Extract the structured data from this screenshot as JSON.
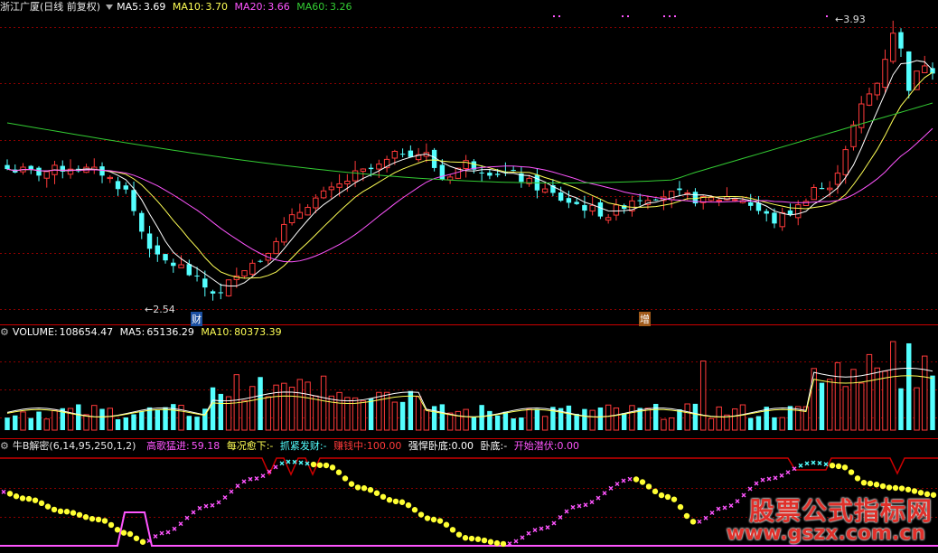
{
  "price_panel": {
    "stock_name": "浙江广厦(日线 前复权)",
    "ma5_label": "MA5:",
    "ma5_value": "3.69",
    "ma10_label": "MA10:",
    "ma10_value": "3.70",
    "ma20_label": "MA20:",
    "ma20_value": "3.66",
    "ma60_label": "MA60:",
    "ma60_value": "3.26",
    "high_marker": "3.93",
    "low_marker": "2.54",
    "event_tag_1": "财",
    "event_tag_2": "增"
  },
  "volume_panel": {
    "volume_label": "VOLUME:",
    "volume_value": "108654.47",
    "ma5_label": "MA5:",
    "ma5_value": "65136.29",
    "ma10_label": "MA10:",
    "ma10_value": "80373.39"
  },
  "indicator_panel": {
    "name": "牛B解密",
    "params": "(6,14,95,250,1,2)",
    "gaoge_label": "高歌猛进:",
    "gaoge_value": "59.18",
    "meikuang_label": "每况愈下:",
    "meikuang_value": "-",
    "zhuajin_label": "抓紧发财:",
    "zhuajin_value": "-",
    "zhuanqian_label": "赚钱中:",
    "zhuanqian_value": "100.00",
    "qianghan_label": "强悍卧底:",
    "qianghan_value": "0.00",
    "wodi_label": "卧底:",
    "wodi_value": "-",
    "kaishi_label": "开始潜伏:",
    "kaishi_value": "0.00"
  },
  "watermark": {
    "line1": "股票公式指标网",
    "line2": "www.gszx.com.cn"
  },
  "colors": {
    "up": "#ff3a3a",
    "down": "#54ffff",
    "ma5": "#ffffff",
    "ma10": "#ffff55",
    "ma20": "#ff55ff",
    "ma60": "#33cc33",
    "grid": "#8a0000",
    "separator": "#cc0000"
  },
  "chart_data": {
    "type": "candlestick",
    "y_price_range": [
      2.54,
      3.93
    ],
    "series_note": "daily candles with MA5/MA10/MA20/MA60, volume bars, indicator dots",
    "price_high": 3.93,
    "price_low": 2.54
  }
}
